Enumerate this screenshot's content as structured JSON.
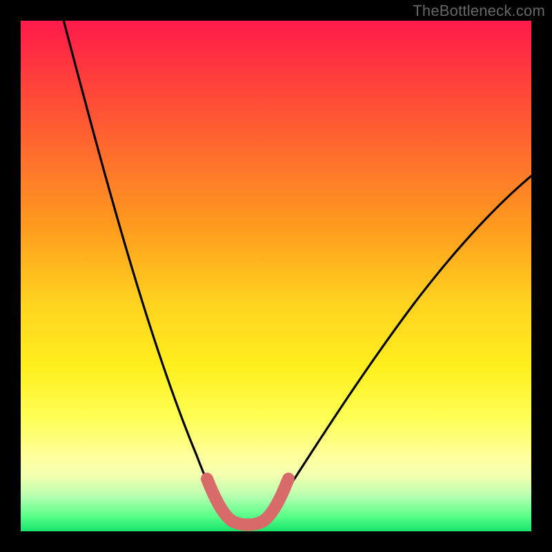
{
  "watermark": "TheBottleneck.com",
  "colors": {
    "background": "#000000",
    "curve_thin": "#000000",
    "curve_thick": "#d86a6a",
    "gradient_top": "#ff1a4a",
    "gradient_bottom": "#16e36a"
  },
  "chart_data": {
    "type": "line",
    "title": "",
    "xlabel": "",
    "ylabel": "",
    "xlim": [
      0,
      100
    ],
    "ylim": [
      0,
      100
    ],
    "x": [
      0,
      5,
      10,
      15,
      20,
      25,
      30,
      33,
      36,
      38,
      40,
      42,
      44,
      46,
      48,
      50,
      55,
      60,
      65,
      70,
      75,
      80,
      85,
      90,
      95,
      100
    ],
    "series": [
      {
        "name": "bottleneck-curve",
        "values": [
          100,
          90,
          80,
          69,
          58,
          46,
          33,
          23,
          13,
          7,
          3,
          2,
          2,
          3,
          6,
          10,
          20,
          28,
          35,
          41,
          46,
          50,
          54,
          57,
          60,
          62
        ]
      }
    ],
    "highlight_band": {
      "x_range": [
        33,
        48
      ],
      "note": "thick salmon segment at valley bottom"
    }
  }
}
